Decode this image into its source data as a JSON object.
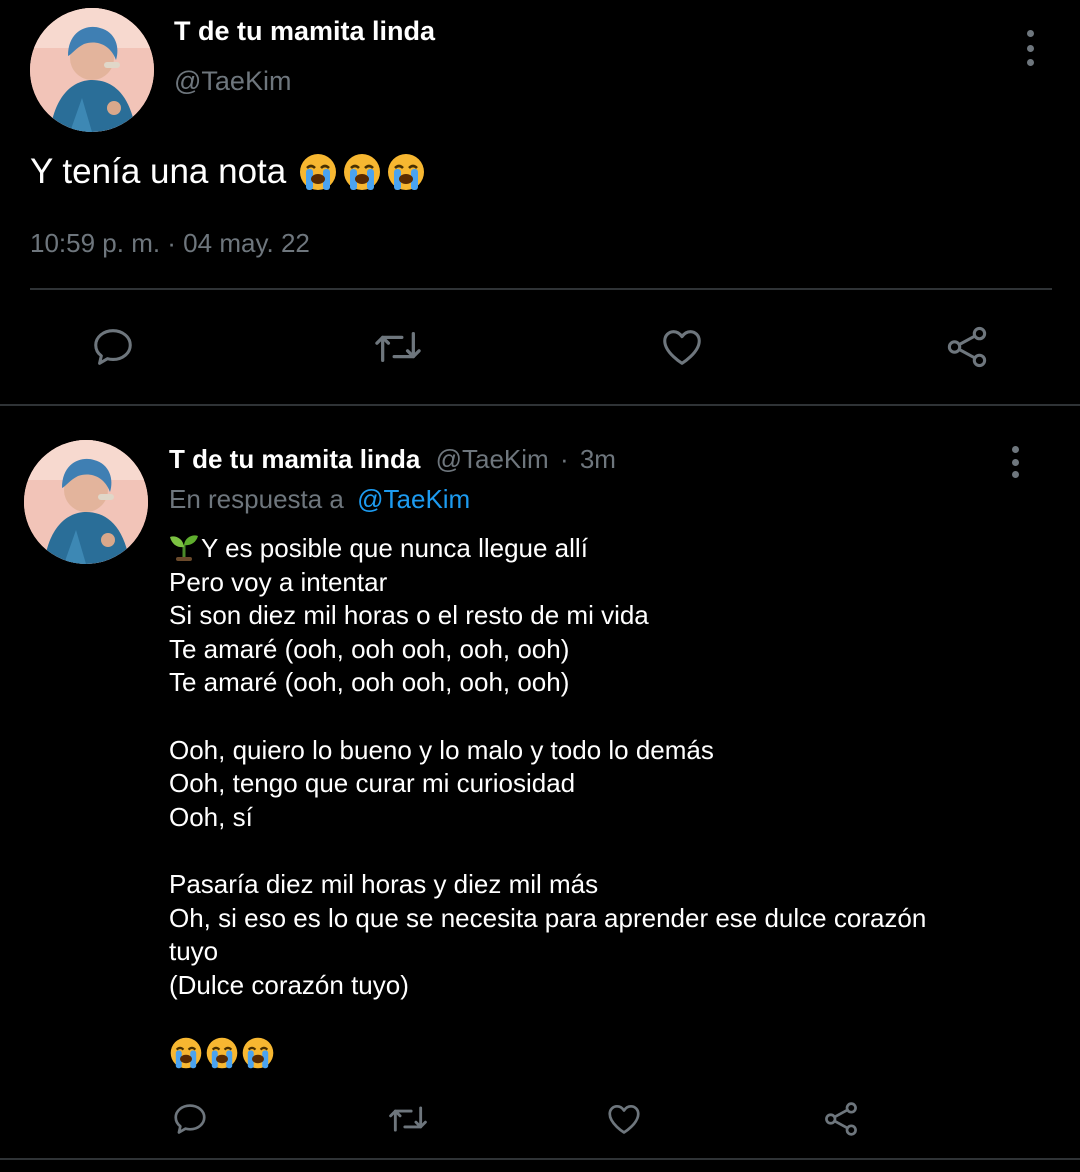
{
  "tweet": {
    "author_name": "T de tu mamita linda",
    "handle": "@TaeKim",
    "text": "Y tenía una nota",
    "emojis": [
      "loudly-crying-face",
      "loudly-crying-face",
      "loudly-crying-face"
    ],
    "timestamp": "10:59 p. m. · 04 may. 22",
    "actions": [
      "reply-icon",
      "retweet-icon",
      "like-icon",
      "share-icon"
    ]
  },
  "reply": {
    "author_name": "T de tu mamita linda",
    "handle": "@TaeKim",
    "separator": "·",
    "age": "3m",
    "reply_prefix": "En respuesta a",
    "reply_to_handle": "@TaeKim",
    "lines": [
      "Y es posible que nunca llegue allí",
      "Pero voy a intentar",
      "Si son diez mil horas o el resto de mi vida",
      "Te amaré (ooh, ooh ooh, ooh, ooh)",
      "Te amaré (ooh, ooh ooh, ooh, ooh)",
      "",
      "Ooh, quiero lo bueno y lo malo y todo lo demás",
      "Ooh, tengo que curar mi curiosidad",
      "Ooh, sí",
      "",
      "Pasaría diez mil horas y diez mil más",
      "Oh, si eso es lo que se necesita para aprender ese dulce corazón",
      "tuyo",
      "(Dulce corazón tuyo)"
    ],
    "lead_emoji": "seedling",
    "emojis": [
      "loudly-crying-face",
      "loudly-crying-face",
      "loudly-crying-face"
    ],
    "actions": [
      "reply-icon",
      "retweet-icon",
      "like-icon",
      "share-icon"
    ]
  },
  "colors": {
    "background": "#000000",
    "text": "#ffffff",
    "muted": "#6e767d",
    "link": "#1d9bf0",
    "divider": "#2f3336"
  }
}
